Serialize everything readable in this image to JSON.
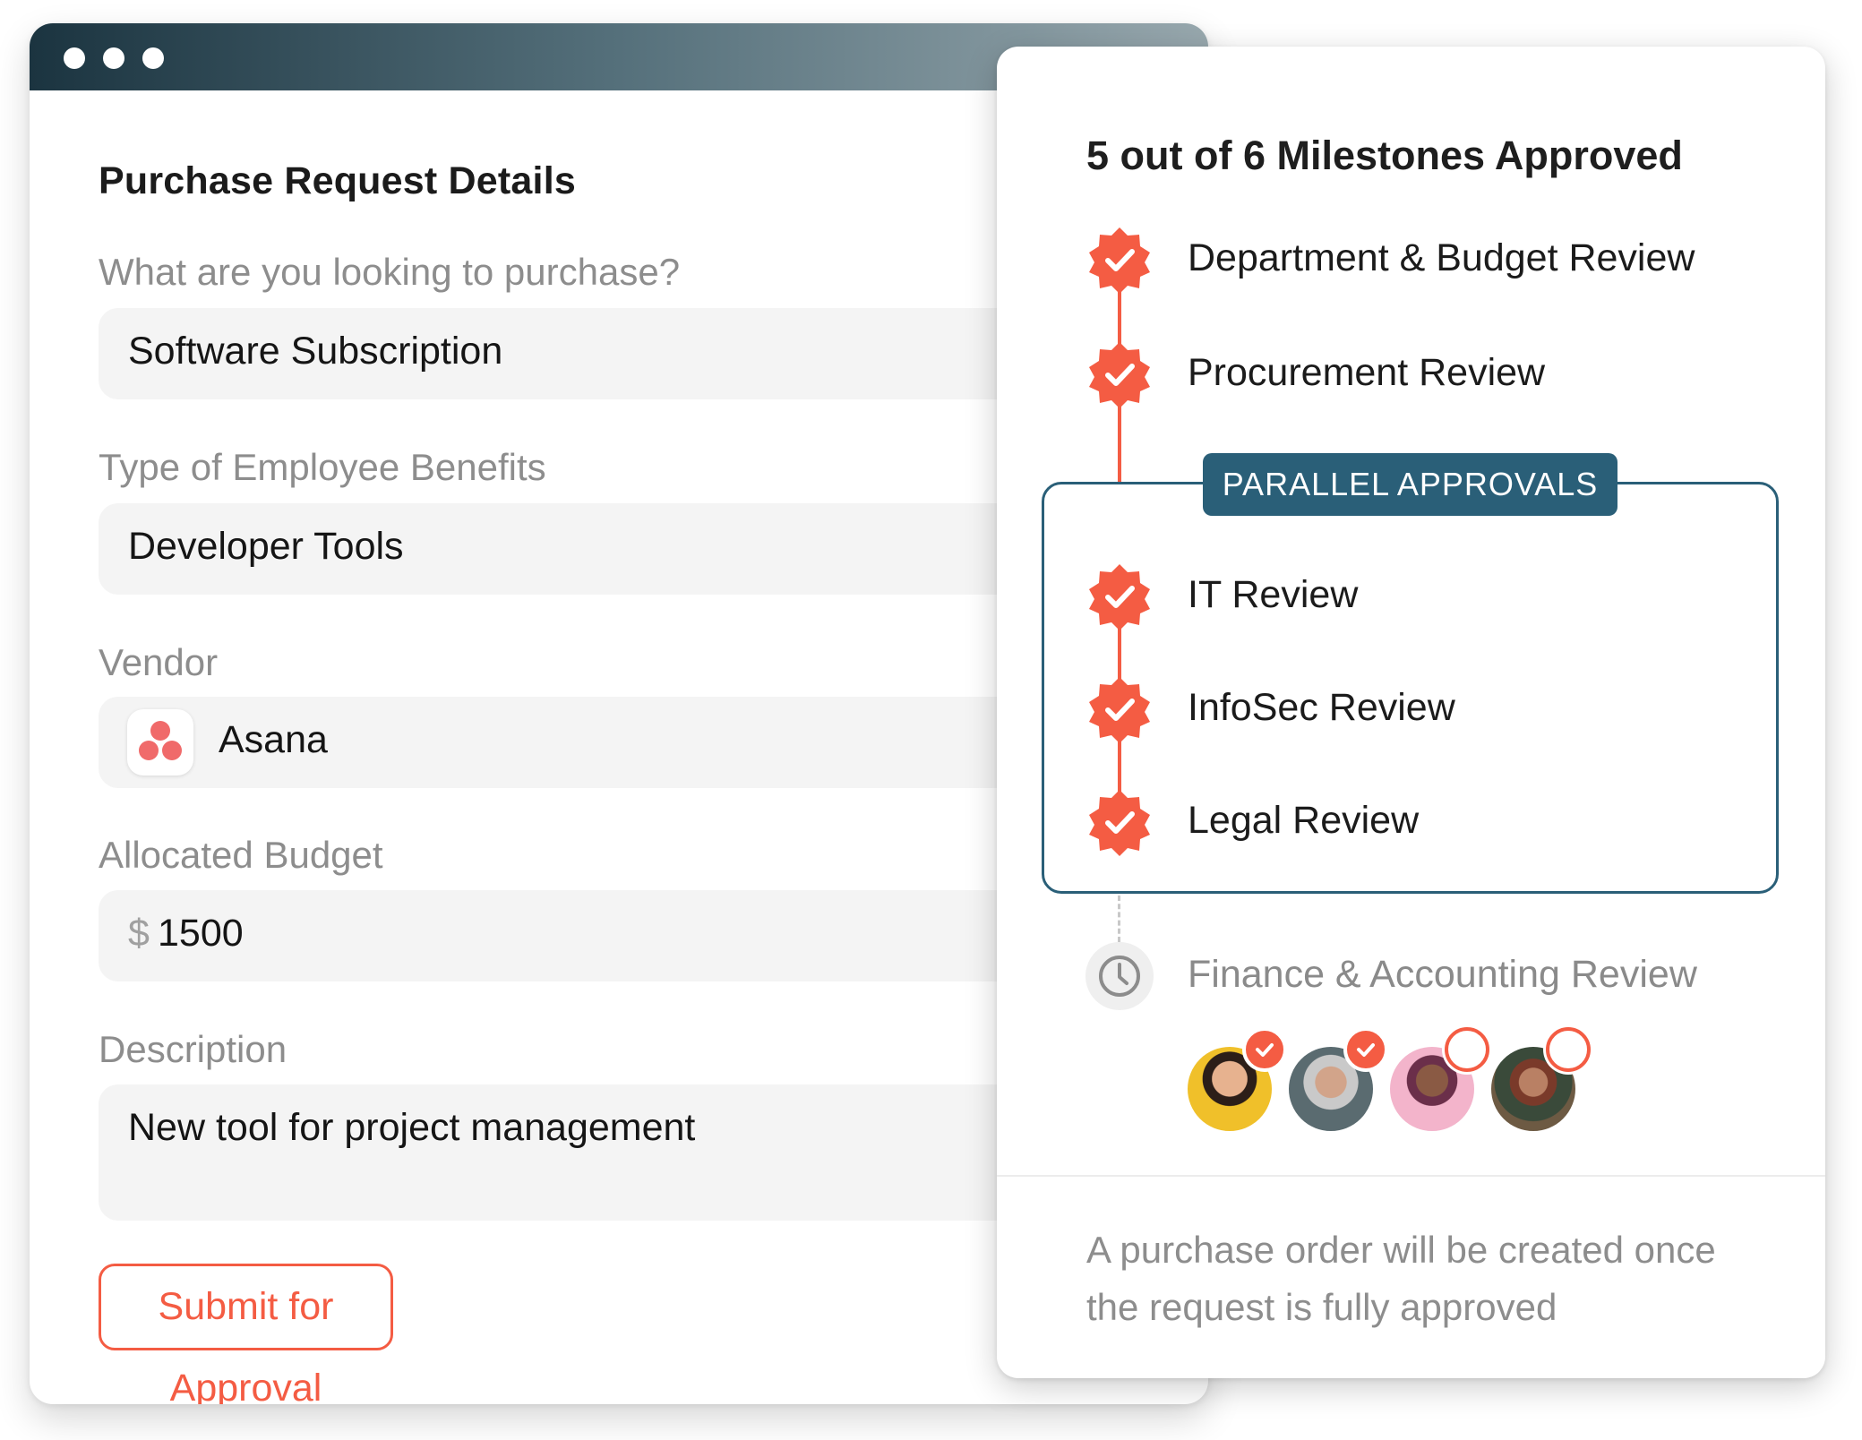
{
  "form": {
    "title": "Purchase Request Details",
    "fields": [
      {
        "label": "What are you looking to purchase?",
        "value": "Software Subscription"
      },
      {
        "label": "Type of Employee Benefits",
        "value": "Developer Tools"
      },
      {
        "label": "Vendor",
        "value": "Asana",
        "icon": "asana-logo"
      },
      {
        "label": "Allocated Budget",
        "currency": "$",
        "value": "1500"
      },
      {
        "label": "Description",
        "value": "New tool for project management"
      }
    ],
    "submit_label": "Submit for Approval"
  },
  "milestones": {
    "title": "5 out of 6 Milestones Approved",
    "parallel_tag": "PARALLEL APPROVALS",
    "items": [
      {
        "label": "Department & Budget Review",
        "status": "approved"
      },
      {
        "label": "Procurement Review",
        "status": "approved"
      },
      {
        "label": "IT Review",
        "status": "approved",
        "group": "parallel"
      },
      {
        "label": "InfoSec Review",
        "status": "approved",
        "group": "parallel"
      },
      {
        "label": "Legal Review",
        "status": "approved",
        "group": "parallel"
      },
      {
        "label": "Finance & Accounting Review",
        "status": "pending"
      }
    ],
    "approvers": [
      {
        "approved": true
      },
      {
        "approved": true
      },
      {
        "approved": false
      },
      {
        "approved": false
      }
    ],
    "footnote": "A purchase order will be created once the request is fully approved"
  },
  "colors": {
    "accent": "#f45c43",
    "parallel": "#2a5f78",
    "asana": "#f06a6a"
  }
}
